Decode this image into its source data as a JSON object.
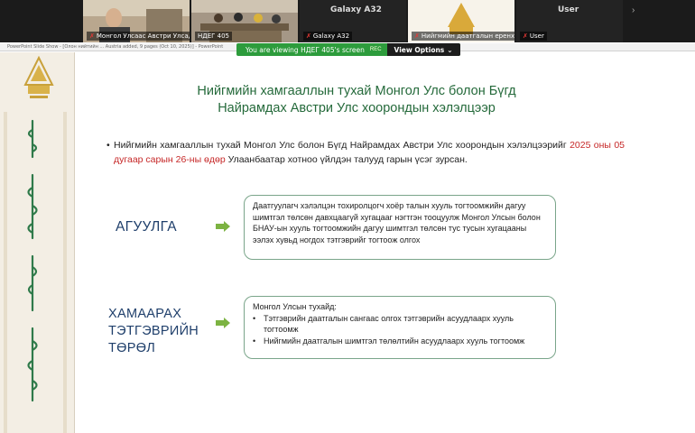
{
  "participants": [
    {
      "name": "",
      "muted": false
    },
    {
      "name": "Монгол Улсаас Австри Улсад с...",
      "muted": true
    },
    {
      "name": "НДЕГ 405",
      "muted": false,
      "active": true
    },
    {
      "name": "Galaxy A32",
      "muted": true,
      "title": "Galaxy A32"
    },
    {
      "name": "Нийгмийн даатгалын еренхий...",
      "muted": true
    },
    {
      "name": "User",
      "muted": true,
      "title": "User"
    }
  ],
  "banner": {
    "viewing_text": "You are viewing НДЕГ 405's screen",
    "rec_label": "REC",
    "options_label": "View Options",
    "options_icon": "chevron-down-icon"
  },
  "ppt_window_title": "PowerPoint Slide Show - [Олон нийтийн ... Austria added, 9 pages (Oct 10, 2025)] - PowerPoint",
  "slide": {
    "title_line1": "Нийгмийн хамгааллын тухай Монгол Улс болон Бүгд",
    "title_line2": "Найрамдах Австри Улс хоорондын хэлэлцээр",
    "bullet_pre": "Нийгмийн хамгааллын тухай Монгол Улс болон Бүгд Найрамдах Австри Улс хоорондын хэлэлцээрийг",
    "bullet_date": "2025 оны 05 дугаар сарын 26-ны өдөр",
    "bullet_post": "Улаанбаатар хотноо үйлдэн талууд гарын үсэг зурсан.",
    "section1": {
      "label": "АГУУЛГА",
      "text": "Даатгуулагч хэлэлцэн тохиролцогч хоёр талын хууль тогтоомжийн дагуу шимтгэл төлсөн давхцаагүй хугацааг нэгтгэн тооцуулж Монгол Улсын болон БНАУ-ын хууль тогтоомжийн дагуу шимтгэл төлсөн тус тусын хугацааны ээлэх хувьд ногдох тэтгэврийг тогтоож олгох"
    },
    "section2": {
      "label_line1": "ХАМААРАХ",
      "label_line2": "ТЭТГЭВРИЙН",
      "label_line3": "ТӨРӨЛ",
      "heading": "Монгол Улсын тухайд:",
      "items": [
        "Тэтгэврийн даатгалын сангаас олгох тэтгэврийн асуудлаарх хууль тогтоомж",
        "Нийгмийн даатгалын шимтгэл төлөлтийн асуудлаарх хууль тогтоомж"
      ]
    }
  },
  "colors": {
    "title": "#256a3b",
    "label": "#1f3f6b",
    "date_highlight": "#c62828",
    "arrow": "#7cb342",
    "box_border": "#7aa58a",
    "banner": "#2d9c3c",
    "left_band": "#f3eee4"
  }
}
